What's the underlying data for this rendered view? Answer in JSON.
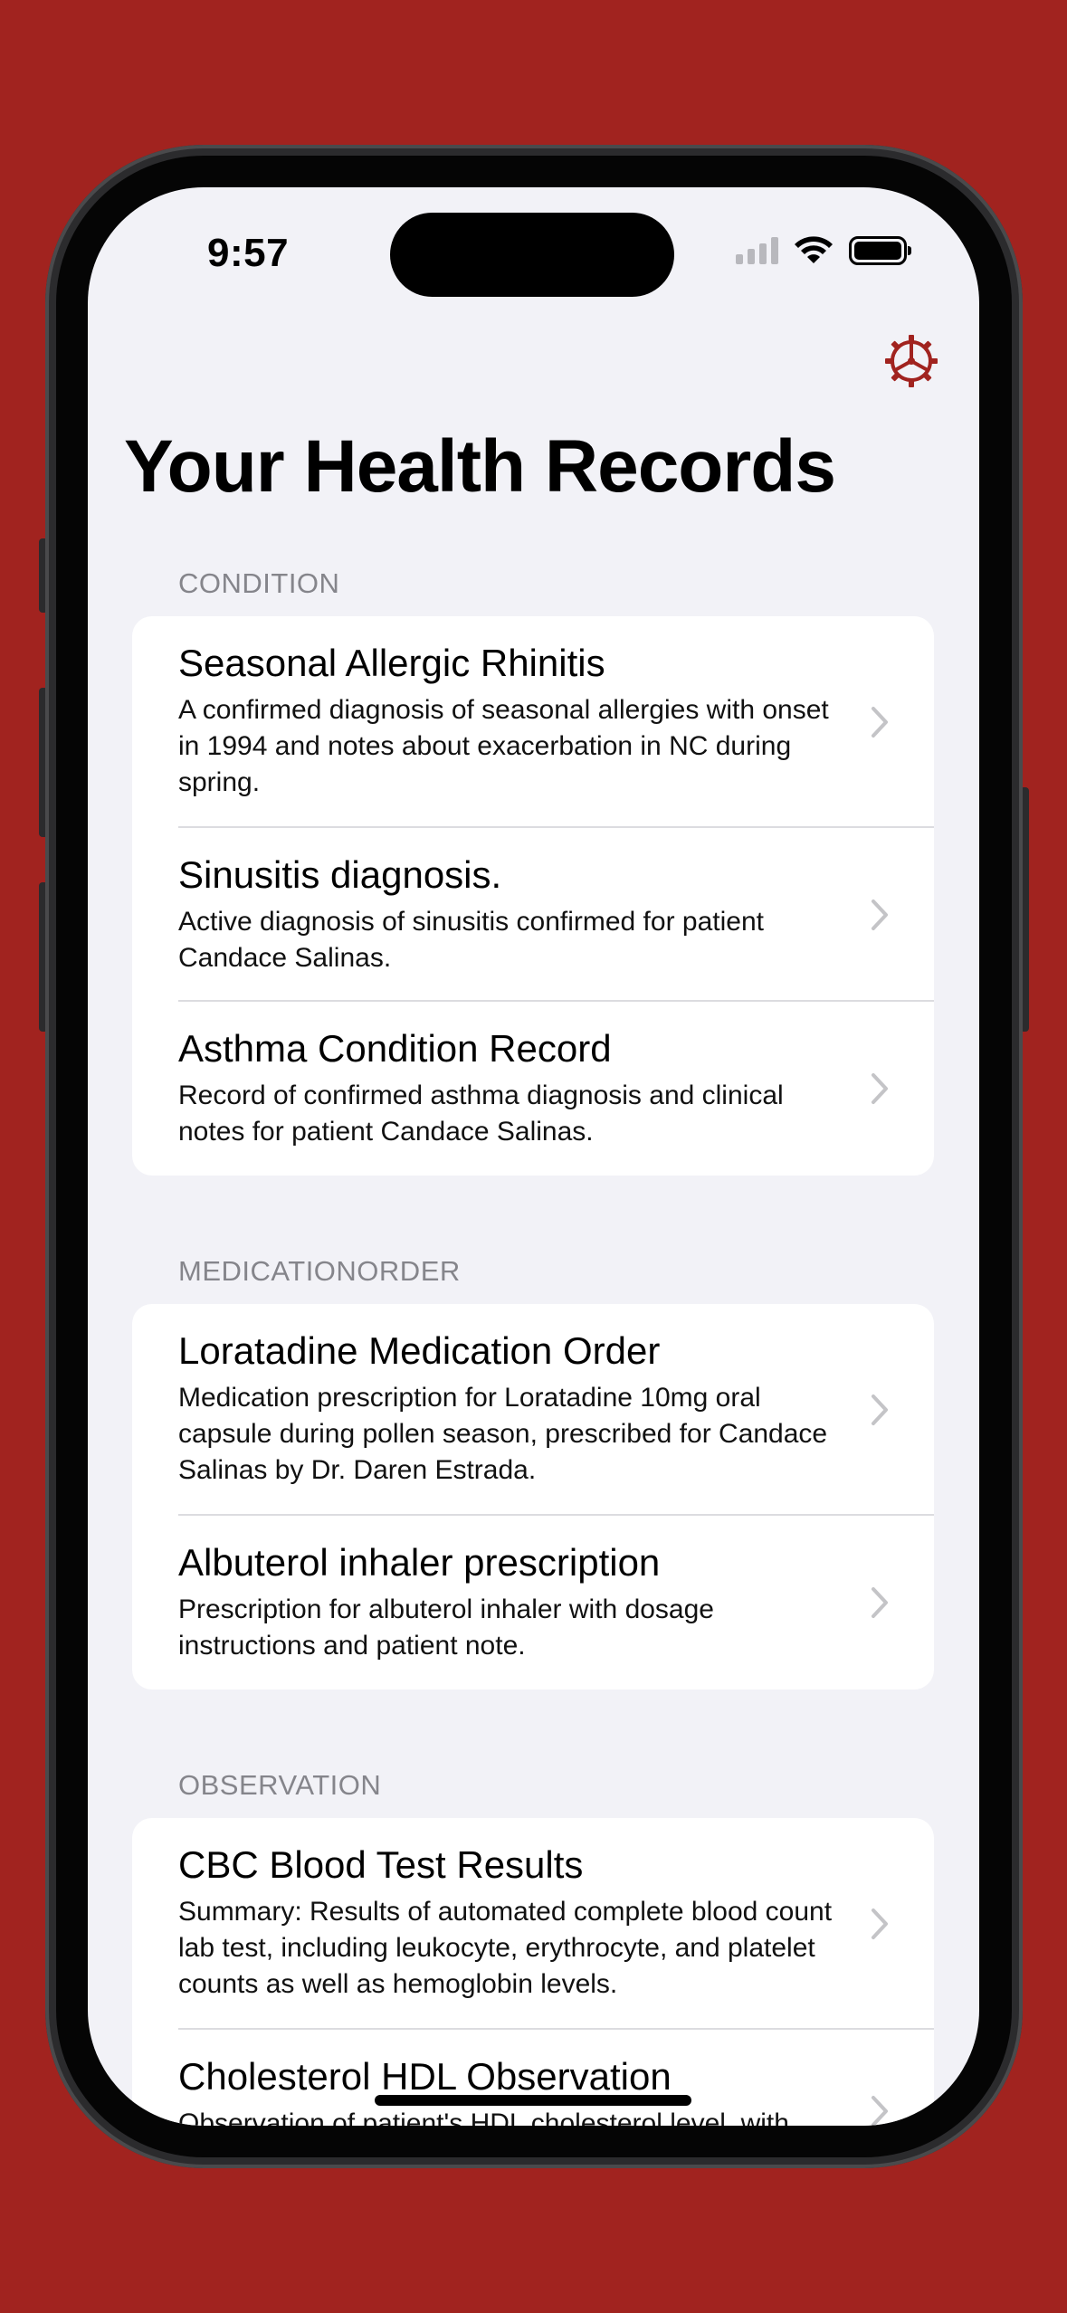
{
  "status_bar": {
    "time": "9:57"
  },
  "header": {
    "title": "Your Health Records",
    "settings_icon": "gear-icon"
  },
  "sections": [
    {
      "header": "CONDITION",
      "items": [
        {
          "title": "Seasonal Allergic Rhinitis",
          "description": "A confirmed diagnosis of seasonal allergies with onset in 1994 and notes about exacerbation in NC during spring."
        },
        {
          "title": "Sinusitis diagnosis.",
          "description": "Active diagnosis of sinusitis confirmed for patient Candace Salinas."
        },
        {
          "title": "Asthma Condition Record",
          "description": "Record of confirmed asthma diagnosis and clinical notes for patient Candace Salinas."
        }
      ]
    },
    {
      "header": "MEDICATIONORDER",
      "items": [
        {
          "title": "Loratadine Medication Order",
          "description": "Medication prescription for Loratadine 10mg oral capsule during pollen season, prescribed for Candace Salinas by Dr. Daren Estrada."
        },
        {
          "title": "Albuterol inhaler prescription",
          "description": "Prescription for albuterol inhaler with dosage instructions and patient note."
        }
      ]
    },
    {
      "header": "OBSERVATION",
      "items": [
        {
          "title": "CBC Blood Test Results",
          "description": "Summary: Results of automated complete blood count lab test, including leukocyte, erythrocyte, and platelet counts as well as hemoglobin levels."
        },
        {
          "title": "Cholesterol HDL Observation",
          "description": "Observation of patient's HDL cholesterol level, with"
        }
      ]
    }
  ],
  "colors": {
    "accent": "#a1231f",
    "background": "#f2f2f7",
    "secondary_text": "#85858b"
  }
}
